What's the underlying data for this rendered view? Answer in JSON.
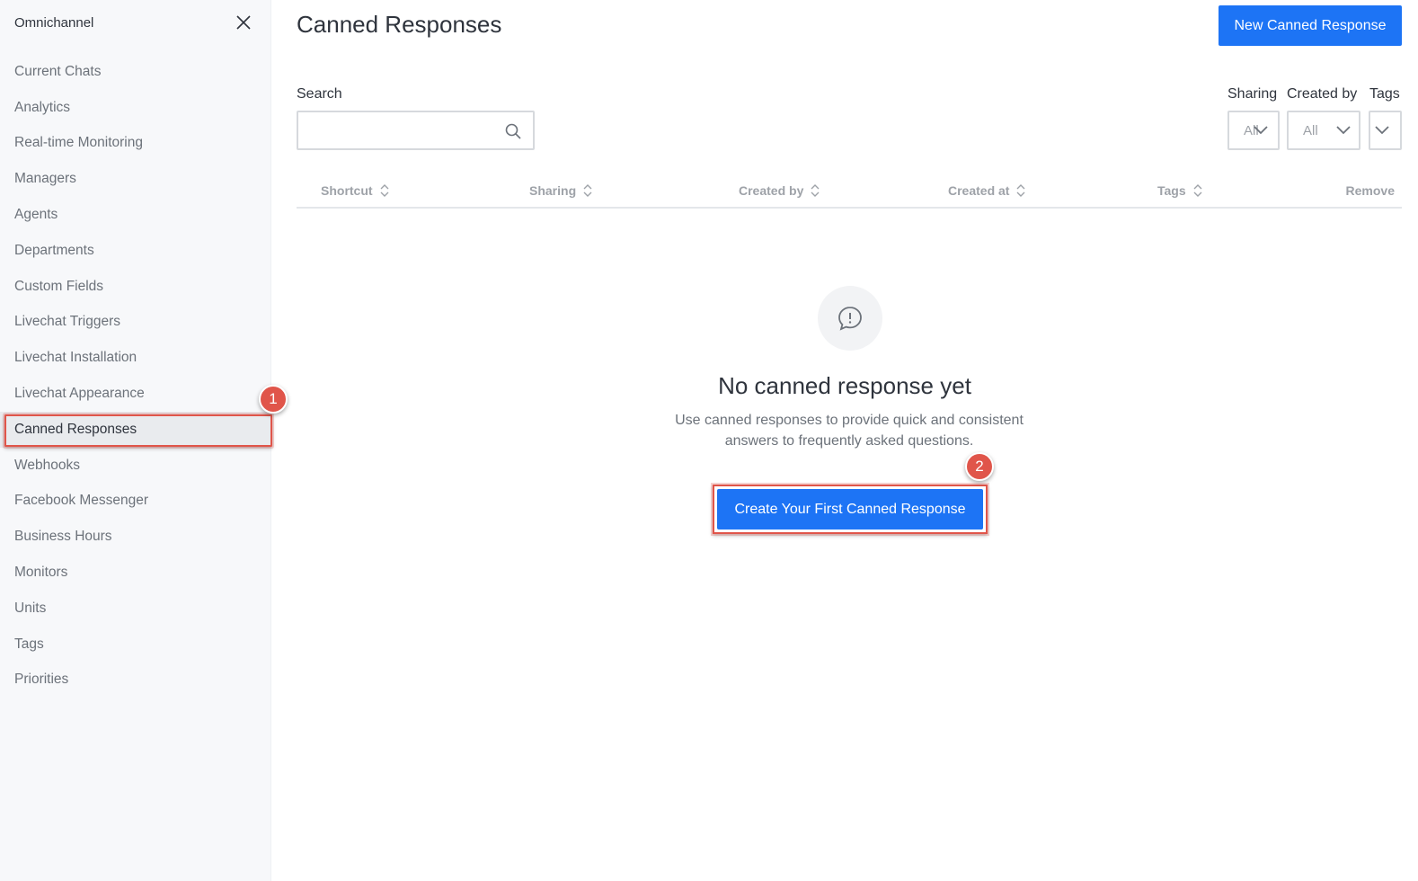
{
  "sidebar": {
    "title": "Omnichannel",
    "items": [
      {
        "label": "Current Chats"
      },
      {
        "label": "Analytics"
      },
      {
        "label": "Real-time Monitoring"
      },
      {
        "label": "Managers"
      },
      {
        "label": "Agents"
      },
      {
        "label": "Departments"
      },
      {
        "label": "Custom Fields"
      },
      {
        "label": "Livechat Triggers"
      },
      {
        "label": "Livechat Installation"
      },
      {
        "label": "Livechat Appearance"
      },
      {
        "label": "Canned Responses"
      },
      {
        "label": "Webhooks"
      },
      {
        "label": "Facebook Messenger"
      },
      {
        "label": "Business Hours"
      },
      {
        "label": "Monitors"
      },
      {
        "label": "Units"
      },
      {
        "label": "Tags"
      },
      {
        "label": "Priorities"
      }
    ],
    "active_item": "Canned Responses"
  },
  "header": {
    "title": "Canned Responses",
    "new_button_label": "New Canned Response"
  },
  "filters": {
    "search_label": "Search",
    "search_value": "",
    "sharing_label": "Sharing",
    "sharing_value": "All",
    "created_by_label": "Created by",
    "created_by_value": "All",
    "tags_label": "Tags"
  },
  "table": {
    "columns": [
      "Shortcut",
      "Sharing",
      "Created by",
      "Created at",
      "Tags",
      "Remove"
    ]
  },
  "empty_state": {
    "title": "No canned response yet",
    "description_line1": "Use canned responses to provide quick and consistent",
    "description_line2": "answers to frequently asked questions.",
    "button_label": "Create Your First Canned Response"
  },
  "annotations": {
    "badge_1": "1",
    "badge_2": "2"
  },
  "colors": {
    "accent": "#1d74f5",
    "callout": "#e0554a"
  }
}
